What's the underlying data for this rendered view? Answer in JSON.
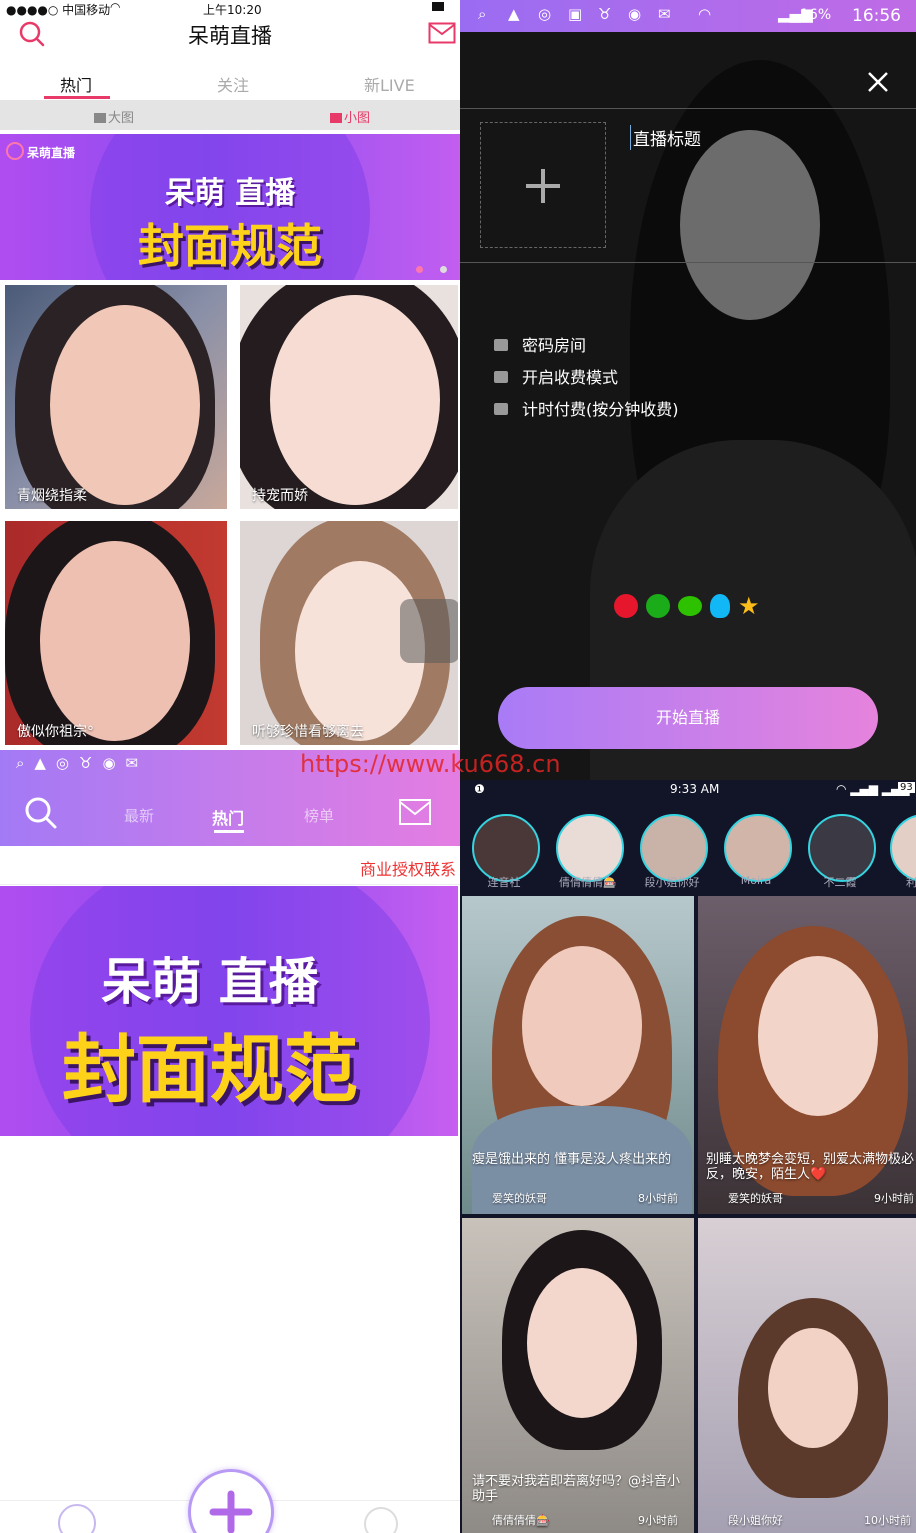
{
  "top_left": {
    "status": {
      "carrier": "●●●●○ 中国移动",
      "time": "上午10:20"
    },
    "title": "呆萌直播",
    "tabs": [
      {
        "label": "热门"
      },
      {
        "label": "关注"
      },
      {
        "label": "新LIVE"
      }
    ],
    "view_toggle": {
      "big": "大图",
      "small": "小图"
    },
    "banner": {
      "logo_text": "呆萌直播",
      "line1": "呆萌 直播",
      "line2": "封面规范"
    },
    "grid": [
      {
        "caption": "青烟绕指柔"
      },
      {
        "caption": "持宠而娇"
      },
      {
        "caption": "傲似你祖宗°"
      },
      {
        "caption": "听够珍惜看够离去"
      }
    ]
  },
  "top_right": {
    "status": {
      "battery": "16%",
      "time": "16:56"
    },
    "title_placeholder": "直播标题",
    "options": [
      {
        "label": "密码房间"
      },
      {
        "label": "开启收费模式"
      },
      {
        "label": "计时付费(按分钟收费)"
      }
    ],
    "share_icons": [
      "weibo-icon",
      "moments-icon",
      "wechat-icon",
      "qq-icon",
      "qzone-icon"
    ],
    "start_button": "开始直播"
  },
  "bottom_left": {
    "nav": [
      {
        "label": "最新"
      },
      {
        "label": "热门"
      },
      {
        "label": "榜单"
      }
    ],
    "marquee": "商业授权联系",
    "banner": {
      "line1": "呆萌 直播",
      "line2": "封面规范"
    }
  },
  "bottom_right": {
    "status": {
      "time": "9:33 AM",
      "battery": "93"
    },
    "avatars": [
      {
        "name": "连音社"
      },
      {
        "name": "倩倩倩倩🎰"
      },
      {
        "name": "段小姐你好"
      },
      {
        "name": "Moira"
      },
      {
        "name": "不二霞"
      },
      {
        "name": "利"
      }
    ],
    "feed": [
      {
        "caption": "瘦是饿出来的 懂事是没人疼出来的",
        "user": "爱笑的妖哥",
        "time": "8小时前"
      },
      {
        "caption": "别睡太晚梦会变短，别爱太满物极必反，晚安，陌生人❤️",
        "user": "爱笑的妖哥",
        "time": "9小时前"
      },
      {
        "caption": "请不要对我若即若离好吗？@抖音小助手",
        "user": "倩倩倩倩🎰",
        "time": "9小时前"
      },
      {
        "caption": "",
        "user": "段小姐你好",
        "time": "10小时前"
      }
    ]
  },
  "watermark": "https://www.ku668.cn",
  "colors": {
    "accent": "#e83a68",
    "purple": "#9b6cf0",
    "pink": "#e97ad9"
  }
}
